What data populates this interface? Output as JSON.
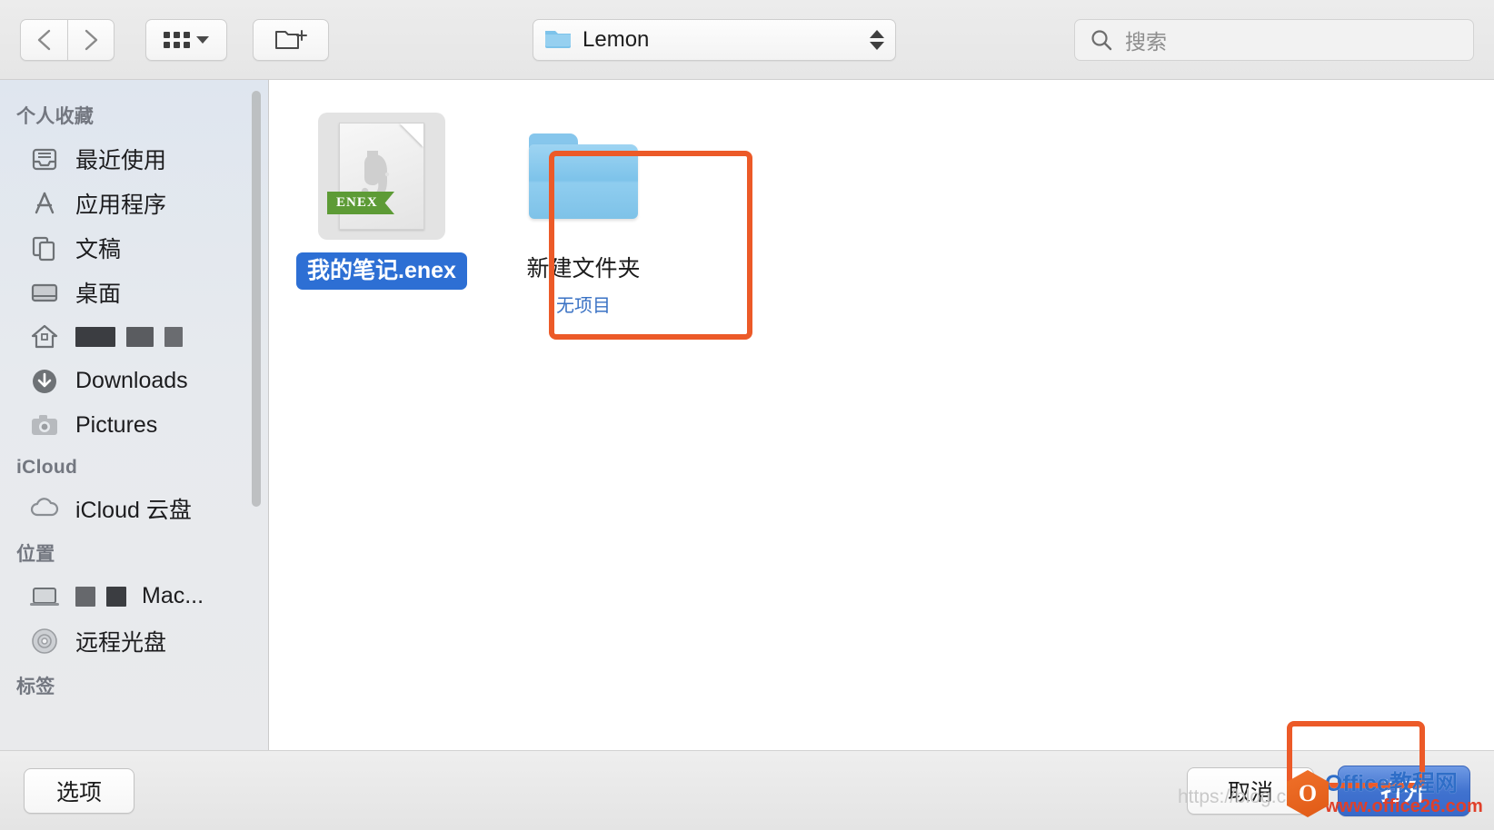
{
  "toolbar": {
    "back_icon": "chevron-left-icon",
    "forward_icon": "chevron-right-icon",
    "view_icon": "icon-view-grid-icon",
    "view_chevron_icon": "chevron-down-icon",
    "new_folder_icon": "new-folder-icon",
    "path": {
      "label": "Lemon",
      "folder_icon": "folder-icon",
      "stepper_icon": "stepper-updown-icon"
    },
    "search": {
      "placeholder": "搜索",
      "value": "",
      "icon": "search-icon"
    }
  },
  "sidebar": {
    "sections": [
      {
        "title": "个人收藏",
        "items": [
          {
            "label": "最近使用",
            "icon": "recents-icon",
            "redacted": false
          },
          {
            "label": "应用程序",
            "icon": "applications-icon",
            "redacted": false
          },
          {
            "label": "文稿",
            "icon": "documents-icon",
            "redacted": false
          },
          {
            "label": "桌面",
            "icon": "desktop-icon",
            "redacted": false
          },
          {
            "label": "",
            "icon": "home-icon",
            "redacted": true
          },
          {
            "label": "Downloads",
            "icon": "downloads-icon",
            "redacted": false
          },
          {
            "label": "Pictures",
            "icon": "pictures-icon",
            "redacted": false
          }
        ]
      },
      {
        "title": "iCloud",
        "items": [
          {
            "label": "iCloud 云盘",
            "icon": "icloud-drive-icon",
            "redacted": false
          }
        ]
      },
      {
        "title": "位置",
        "items": [
          {
            "label": "Mac...",
            "icon": "laptop-icon",
            "redacted": true
          },
          {
            "label": "远程光盘",
            "icon": "remote-disc-icon",
            "redacted": false
          }
        ]
      },
      {
        "title": "标签",
        "items": []
      }
    ],
    "scrollbar": "vertical-scrollbar"
  },
  "files": [
    {
      "name": "我的笔记.enex",
      "subtitle": "",
      "kind": "file",
      "badge": "ENEX",
      "icon": "evernote-enex-file-icon",
      "selected": true
    },
    {
      "name": "新建文件夹",
      "subtitle": "无项目",
      "kind": "folder",
      "badge": "",
      "icon": "folder-icon",
      "selected": false
    }
  ],
  "footer": {
    "options_label": "选项",
    "cancel_label": "取消",
    "open_label": "打开"
  },
  "watermarks": {
    "csdn": "https://blog.csdn.",
    "office_logo_letter": "O",
    "office_cn": "Office教程网",
    "office_url": "www.office26.com"
  },
  "colors": {
    "annotation": "#ec5a28",
    "selection_blue": "#2d6fd4",
    "open_button_blue": "#4072cf",
    "enex_badge_green": "#5d9b36",
    "folder_blue": "#7dc3ea",
    "subtitle_blue": "#3a72c4"
  }
}
